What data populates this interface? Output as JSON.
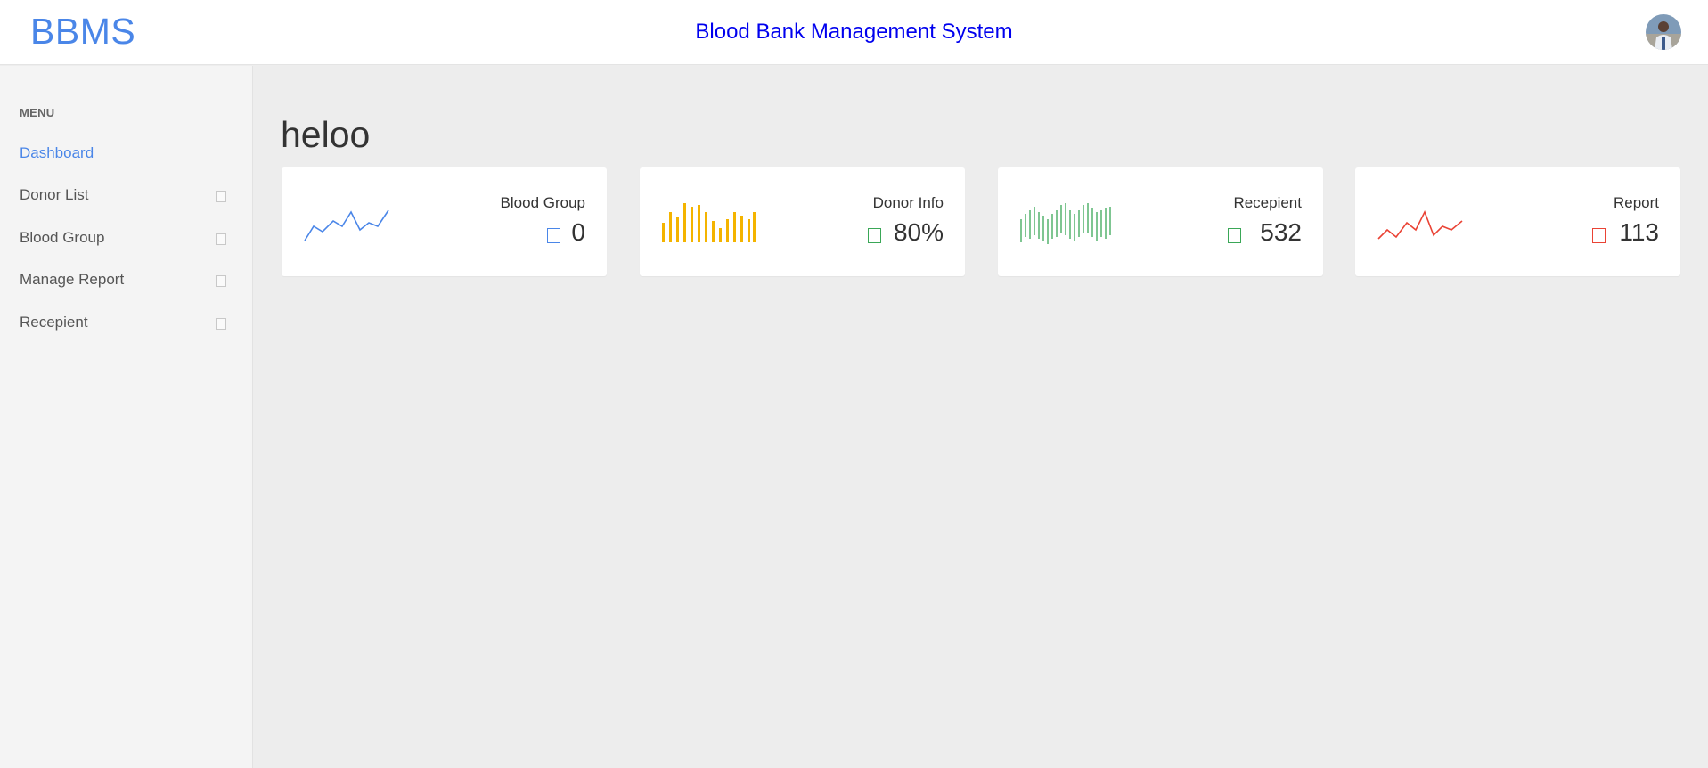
{
  "header": {
    "brand": "BBMS",
    "title": "Blood Bank Management System",
    "avatar_icon": "user-avatar"
  },
  "sidebar": {
    "heading": "MENU",
    "items": [
      {
        "label": "Dashboard",
        "active": true
      },
      {
        "label": "Donor List",
        "icon": "box-icon"
      },
      {
        "label": "Blood Group",
        "icon": "box-icon"
      },
      {
        "label": "Manage Report",
        "icon": "box-icon"
      },
      {
        "label": "Recepient",
        "icon": "box-icon"
      }
    ]
  },
  "main": {
    "heading": "heloo",
    "cards": [
      {
        "title": "Blood Group",
        "value": "0",
        "color": "#4a86e8",
        "chart": "line"
      },
      {
        "title": "Donor Info",
        "value": "80%",
        "color": "#f4b400",
        "chart": "bar"
      },
      {
        "title": "Recepient",
        "value": "532",
        "color": "#3aa757",
        "chart": "bar-thin"
      },
      {
        "title": "Report",
        "value": "113",
        "color": "#ea4335",
        "chart": "line"
      }
    ]
  },
  "colors": {
    "brand": "#4a86e8",
    "title_link": "#0000ee",
    "sidebar_bg": "#f4f4f4",
    "content_bg": "#ededed"
  }
}
